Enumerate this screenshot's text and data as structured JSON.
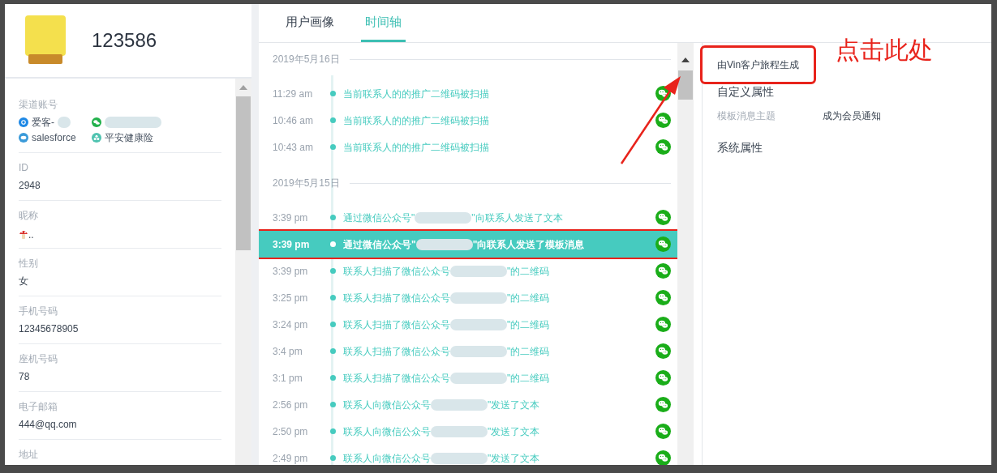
{
  "profile": {
    "name": "123586"
  },
  "fields": [
    {
      "label": "渠道账号",
      "kind": "channels",
      "channels": [
        {
          "name": "爱客-",
          "kind": "circle",
          "redacted": true
        },
        {
          "kind": "wechat",
          "redacted": true
        },
        {
          "name": "salesforce",
          "kind": "chat",
          "redacted": false
        },
        {
          "name": "平安健康险",
          "kind": "flower",
          "redacted": false
        }
      ]
    },
    {
      "label": "ID",
      "kind": "text",
      "value": "2948"
    },
    {
      "label": "昵称",
      "kind": "mushroom",
      "value": ".."
    },
    {
      "label": "性别",
      "kind": "text",
      "value": "女"
    },
    {
      "label": "手机号码",
      "kind": "text",
      "value": "12345678905"
    },
    {
      "label": "座机号码",
      "kind": "text",
      "value": "78"
    },
    {
      "label": "电子邮箱",
      "kind": "text",
      "value": "444@qq.com"
    },
    {
      "label": "地址",
      "kind": "text"
    }
  ],
  "tabs": [
    {
      "label": "用户画像",
      "selected": false
    },
    {
      "label": "时间轴",
      "selected": true
    }
  ],
  "timeline": [
    {
      "date": "2019年5月16日",
      "events": [
        {
          "time": "11:29 am",
          "parts": [
            "当前联系人的的推广二维码被扫描"
          ],
          "selected": false
        },
        {
          "time": "10:46 am",
          "parts": [
            "当前联系人的的推广二维码被扫描"
          ],
          "selected": false
        },
        {
          "time": "10:43 am",
          "parts": [
            "当前联系人的的推广二维码被扫描"
          ],
          "selected": false
        }
      ]
    },
    {
      "date": "2019年5月15日",
      "events": [
        {
          "time": "3:39 pm",
          "parts": [
            "通过微信公众号\"",
            "\"向联系人发送了文本"
          ],
          "selected": false
        },
        {
          "time": "3:39 pm",
          "parts": [
            "通过微信公众号\"",
            "\"向联系人发送了模板消息"
          ],
          "selected": true
        },
        {
          "time": "3:39 pm",
          "parts": [
            "联系人扫描了微信公众号",
            "\"的二维码"
          ],
          "selected": false
        },
        {
          "time": "3:25 pm",
          "parts": [
            "联系人扫描了微信公众号",
            "\"的二维码"
          ],
          "selected": false
        },
        {
          "time": "3:24 pm",
          "parts": [
            "联系人扫描了微信公众号",
            "\"的二维码"
          ],
          "selected": false
        },
        {
          "time": "3:4 pm",
          "parts": [
            "联系人扫描了微信公众号",
            "\"的二维码"
          ],
          "selected": false
        },
        {
          "time": "3:1 pm",
          "parts": [
            "联系人扫描了微信公众号",
            "\"的二维码"
          ],
          "selected": false
        },
        {
          "time": "2:56 pm",
          "parts": [
            "联系人向微信公众号",
            "\"发送了文本"
          ],
          "selected": false
        },
        {
          "time": "2:50 pm",
          "parts": [
            "联系人向微信公众号",
            "\"发送了文本"
          ],
          "selected": false
        },
        {
          "time": "2:49 pm",
          "parts": [
            "联系人向微信公众号",
            "\"发送了文本"
          ],
          "selected": false
        }
      ]
    }
  ],
  "detail": {
    "source": {
      "text": "由Vin客户旅程生成",
      "highlighted": true
    },
    "sections": [
      {
        "title": "自定义属性",
        "attributes": [
          {
            "label": "模板消息主题",
            "value": "成为会员通知"
          }
        ]
      },
      {
        "title": "系统属性"
      }
    ]
  },
  "annotation": {
    "text": "点击此处"
  }
}
